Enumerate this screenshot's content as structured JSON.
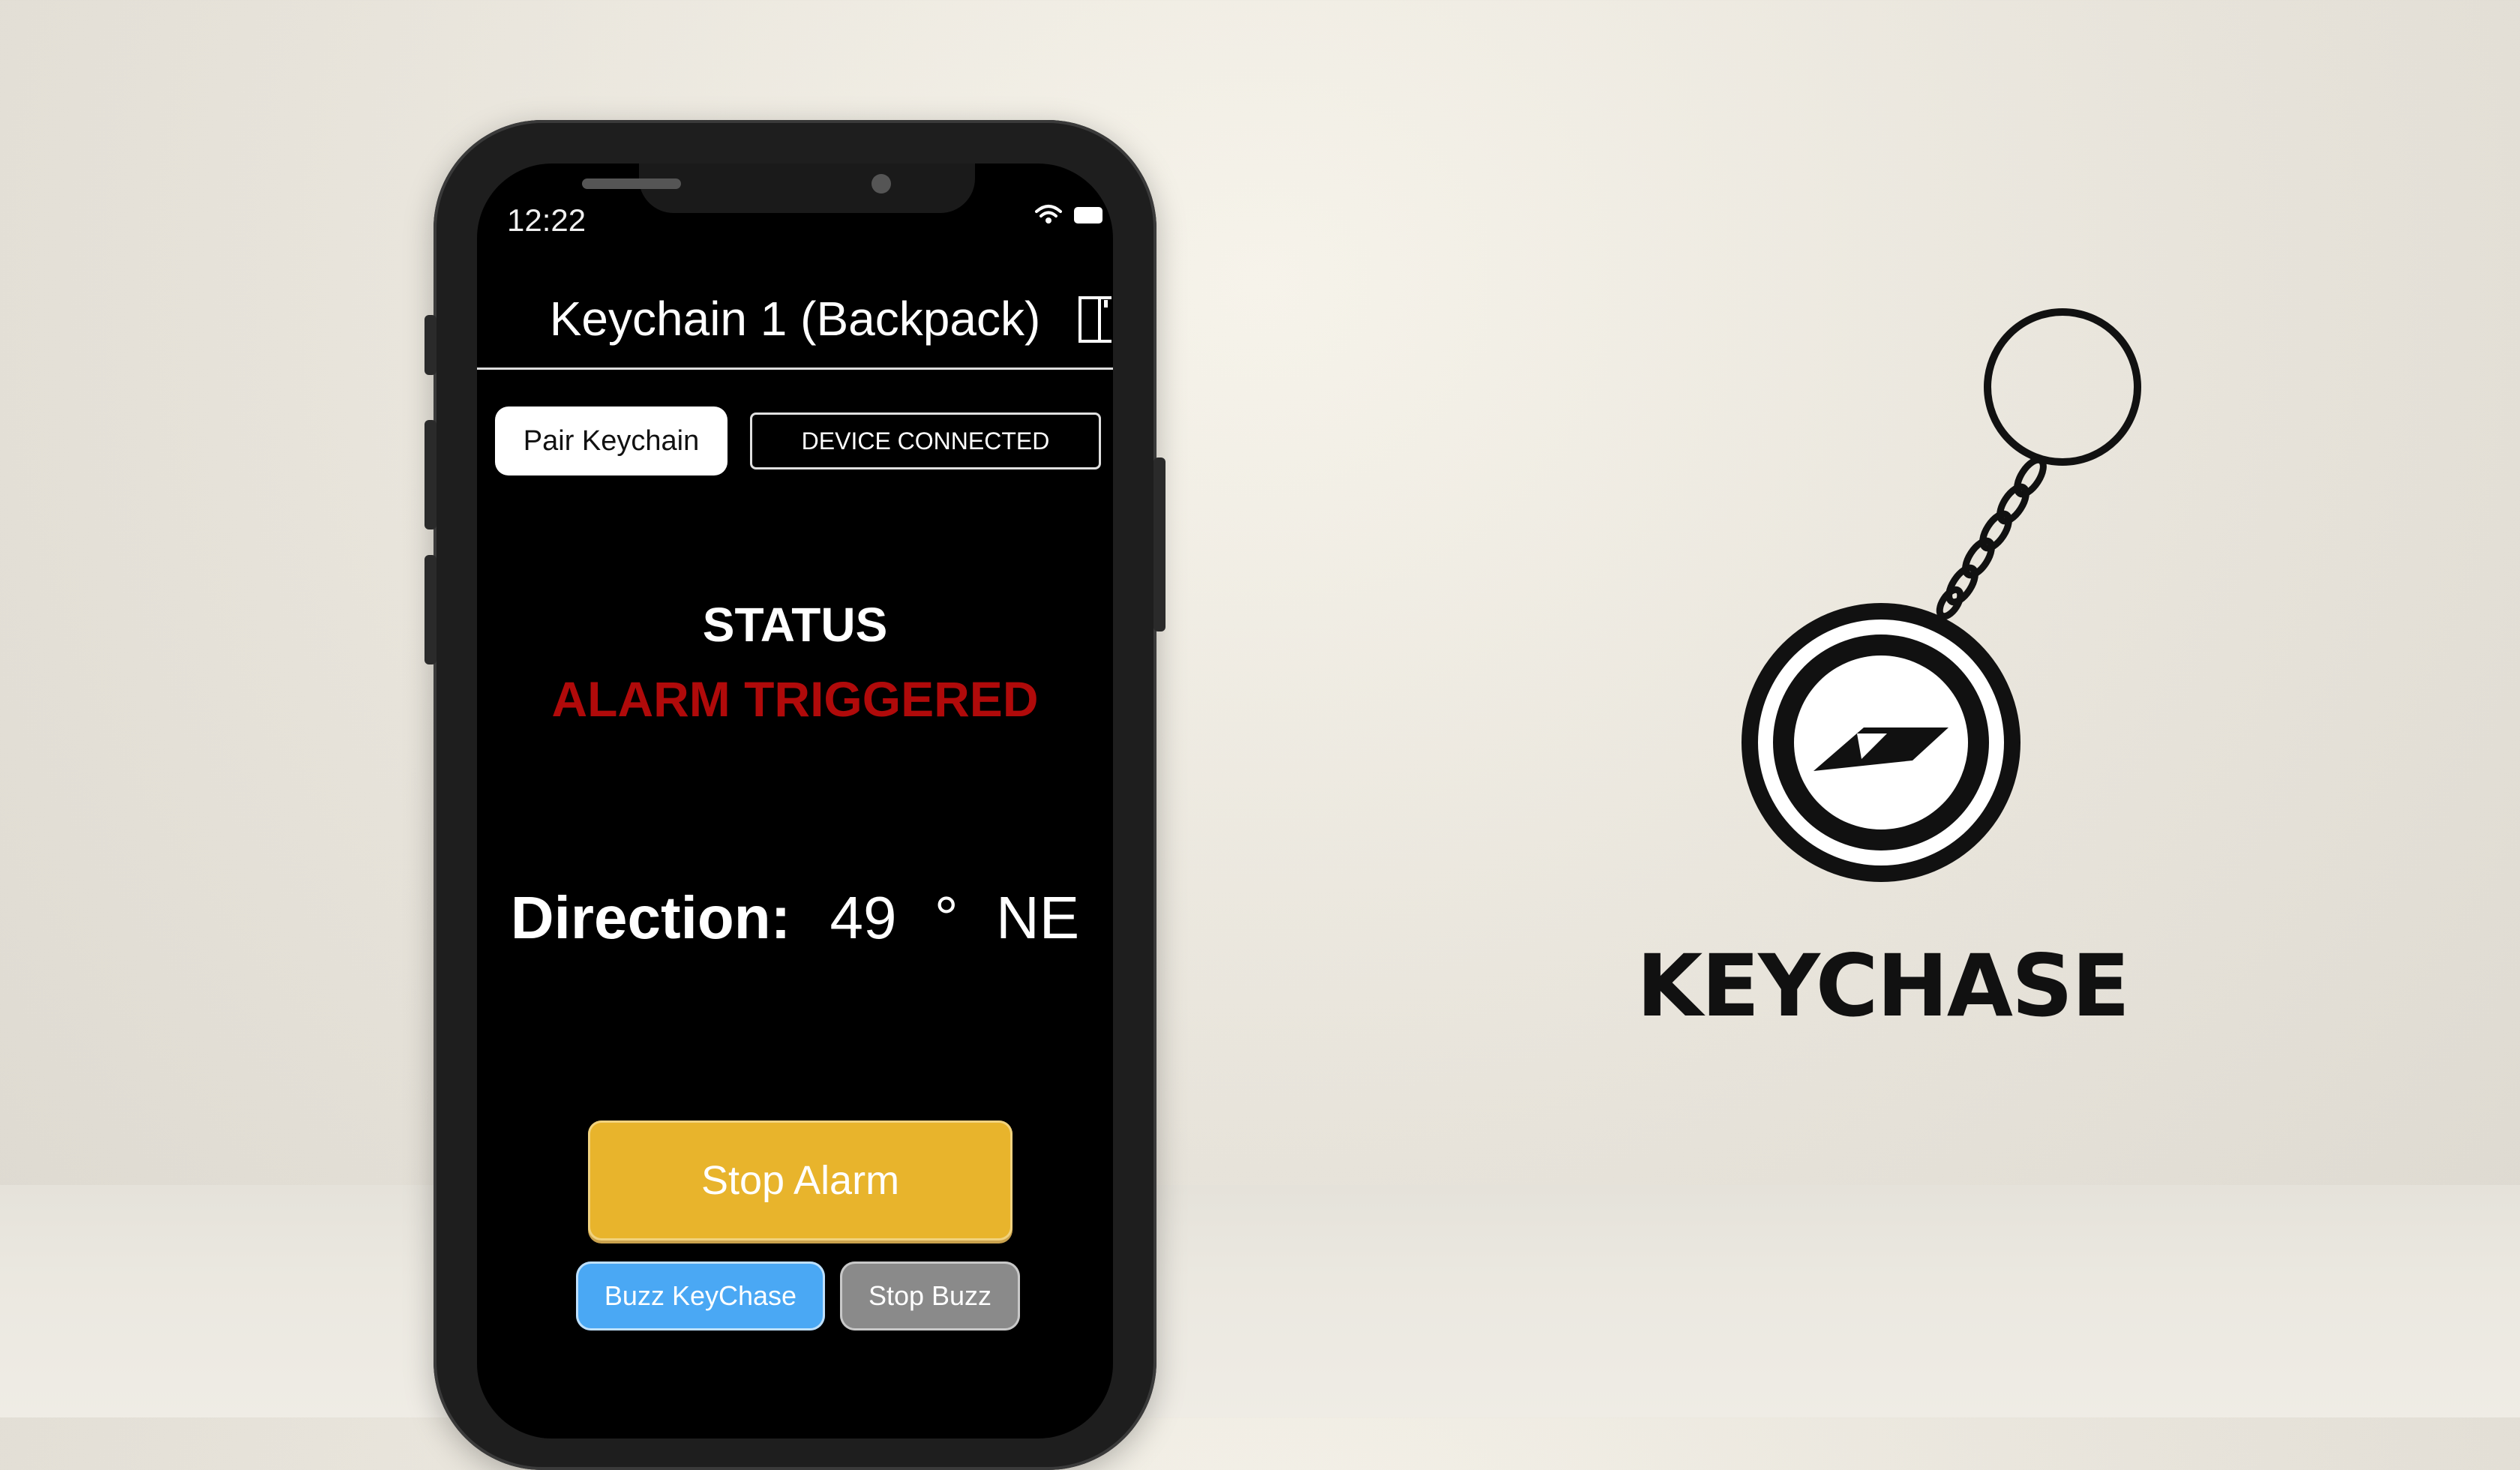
{
  "status_bar": {
    "time": "12:22"
  },
  "header": {
    "title": "Keychain 1 (Backpack)"
  },
  "controls": {
    "pair_label": "Pair Keychain",
    "connection_status": "DEVICE CONNECTED"
  },
  "status": {
    "label": "STATUS",
    "value": "ALARM TRIGGERED",
    "value_color": "#b00a0a"
  },
  "direction": {
    "label": "Direction:",
    "degrees": "49",
    "unit": "°",
    "cardinal": "NE"
  },
  "actions": {
    "stop_alarm_label": "Stop Alarm",
    "buzz_label": "Buzz KeyChase",
    "stop_buzz_label": "Stop Buzz",
    "stop_alarm_color": "#e8b42c",
    "buzz_color": "#4aa8f4",
    "stop_buzz_color": "#8a8a8a"
  },
  "brand": {
    "name": "KEYCHASE",
    "logo_icon": "keychain-compass-icon"
  }
}
